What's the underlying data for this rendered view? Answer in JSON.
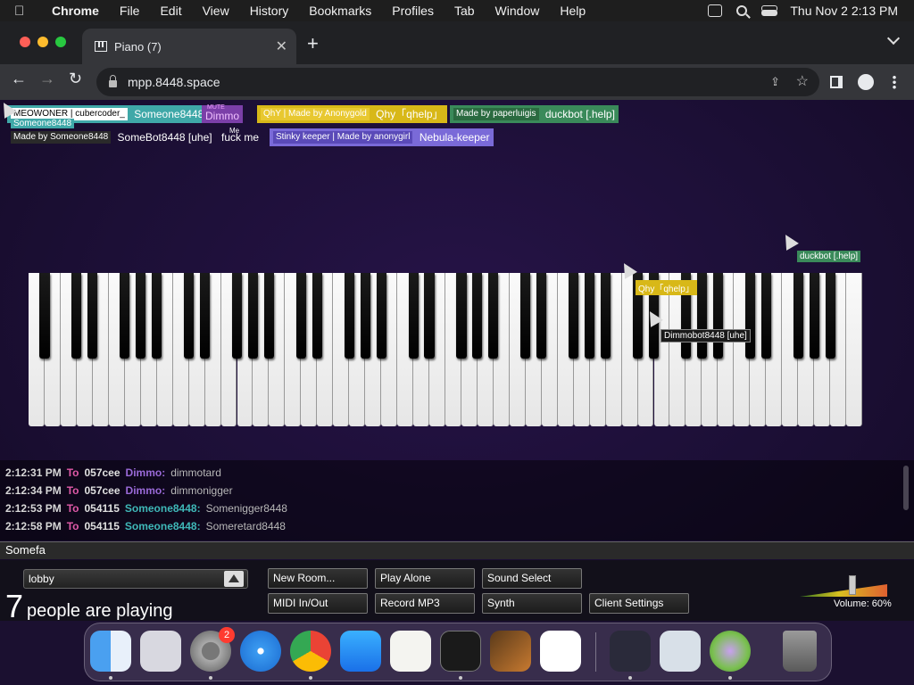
{
  "menubar": {
    "app": "Chrome",
    "items": [
      "File",
      "Edit",
      "View",
      "History",
      "Bookmarks",
      "Profiles",
      "Tab",
      "Window",
      "Help"
    ],
    "clock": "Thu Nov 2  2:13 PM"
  },
  "browser": {
    "tab_title": "Piano (7)",
    "url": "mpp.8448.space"
  },
  "participants": [
    {
      "tag": "MEOWONER | cubercoder_",
      "name": "Someone8448",
      "color": "#3fa8a8",
      "tag_bg": "#ffffff",
      "tag_color": "#000000"
    },
    {
      "tag": "MUTE",
      "name": "Dimmo",
      "color": "#7b3fa8",
      "tag_bg": "",
      "tag_color": "#f0a0ff"
    },
    {
      "tag": "QhY | Made by Anonygold",
      "name": "Qhy「qhelp」",
      "color": "#d8b818",
      "tag_bg": "#e0c020",
      "tag_color": "#ffffff"
    },
    {
      "tag": "Made by paperluigis",
      "name": "duckbot [.help]",
      "color": "#3a8a5a",
      "tag_bg": "#2a6a40",
      "tag_color": "#ffffff"
    },
    {
      "tag": "Made by Someone8448",
      "name": "SomeBot8448 [uhe]",
      "color": "",
      "tag_bg": "#2a2a2a",
      "tag_color": "#ffffff"
    },
    {
      "tag": "Me",
      "name": "fuck me",
      "color": "",
      "tag_bg": "",
      "tag_color": "#ffffff"
    },
    {
      "tag": "Stinky keeper | Made by anonygirl",
      "name": "Nebula-keeper",
      "color": "#7a6ad8",
      "tag_bg": "#5a4ab8",
      "tag_color": "#ffffff"
    }
  ],
  "sublabel": "Someone8448",
  "cursors": [
    {
      "label": "duckbot [.help]",
      "bg": "#3a8a5a"
    },
    {
      "label": "Qhy「qhelp」",
      "bg": "#d8b818"
    },
    {
      "label": "Dimmobot8448 [uhe]",
      "bg": "#1a1a1a"
    }
  ],
  "chat": [
    {
      "time": "2:12:31 PM",
      "to": "To",
      "target": "057cee",
      "from": "Dimmo:",
      "from_color": "#9a6ad8",
      "text": "dimmotard"
    },
    {
      "time": "2:12:34 PM",
      "to": "To",
      "target": "057cee",
      "from": "Dimmo:",
      "from_color": "#9a6ad8",
      "text": "dimmonigger"
    },
    {
      "time": "2:12:53 PM",
      "to": "To",
      "target": "054115",
      "from": "Someone8448:",
      "from_color": "#3fb8b8",
      "text": "Somenigger8448"
    },
    {
      "time": "2:12:58 PM",
      "to": "To",
      "target": "054115",
      "from": "Someone8448:",
      "from_color": "#3fb8b8",
      "text": "Someretard8448"
    }
  ],
  "chat_input": "Somefa",
  "bottom": {
    "room": "lobby",
    "people_count": "7",
    "people_label": "people are playing",
    "buttons": {
      "new_room": "New Room...",
      "play_alone": "Play Alone",
      "sound_select": "Sound Select",
      "midi": "MIDI In/Out",
      "record": "Record MP3",
      "synth": "Synth",
      "client_settings": "Client Settings"
    },
    "volume_label": "Volume: 60%",
    "volume_value": 0.6
  },
  "dock": {
    "settings_badge": "2",
    "apps": [
      "finder-icon",
      "launchpad-icon",
      "system-settings-icon",
      "safari-icon",
      "chrome-icon",
      "app-store-icon",
      "textedit-icon",
      "terminal-icon",
      "garageband-icon",
      "vscode-icon",
      "nox-icon",
      "preview-icon",
      "installer-icon",
      "trash-icon"
    ]
  }
}
